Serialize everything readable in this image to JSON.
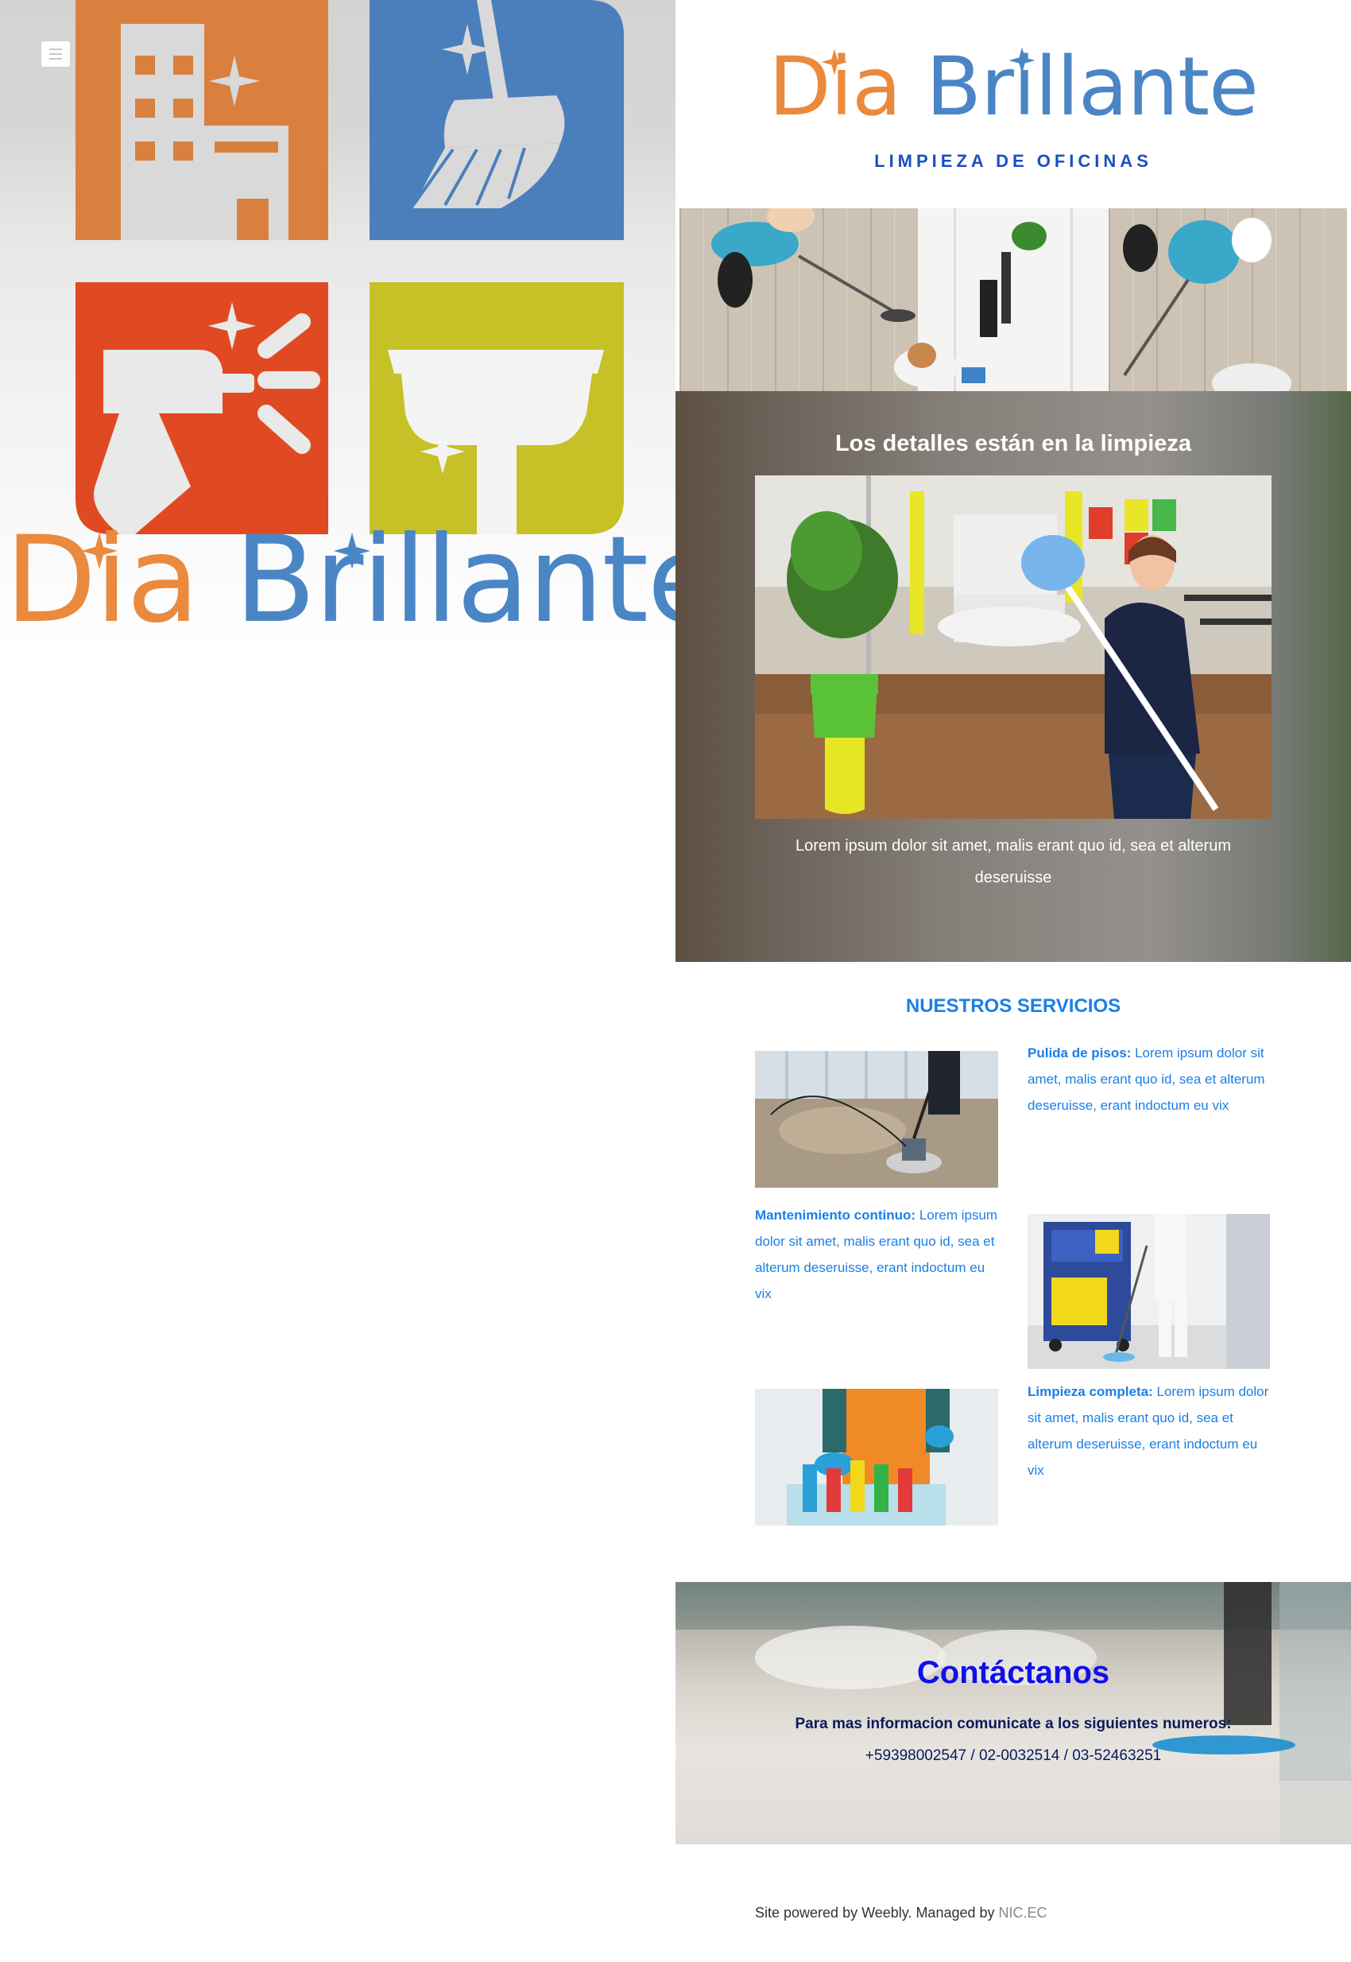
{
  "brand": {
    "name_part1": "Dia",
    "name_part2": "Brillante",
    "tagline": "LIMPIEZA DE OFICINAS"
  },
  "header": {
    "menu_icon": "hamburger-menu-icon"
  },
  "detail": {
    "title": "Los detalles están en la limpieza",
    "text": "Lorem ipsum dolor sit amet, malis erant quo id, sea et alterum deseruisse"
  },
  "services": {
    "title": "NUESTROS SERVICIOS",
    "items": [
      {
        "name": "Pulida de pisos:",
        "text": " Lorem ipsum dolor sit amet, malis erant quo id, sea et alterum deseruisse, erant indoctum eu vix"
      },
      {
        "name": "Mantenimiento continuo:",
        "text": " Lorem ipsum dolor sit amet, malis erant quo id, sea et alterum deseruisse, erant indoctum eu vix"
      },
      {
        "name": "Limpieza completa:",
        "text": " Lorem ipsum dolor sit amet, malis erant quo id, sea et alterum deseruisse, erant indoctum eu vix"
      }
    ]
  },
  "contact": {
    "title": "Contáctanos",
    "line1": "Para mas informacion comunicate a los siguientes numeros:",
    "phones": "+59398002547 / 02-0032514 / 03-52463251"
  },
  "footer": {
    "text": "Site powered by Weebly. Managed by ",
    "link": "NIC.EC"
  },
  "colors": {
    "orange": "#ea8a3e",
    "blue": "#4a86c5",
    "red": "#e04a22",
    "olive": "#c9c526",
    "services_blue": "#1b7fe6",
    "contact_blue": "#1010e8"
  }
}
